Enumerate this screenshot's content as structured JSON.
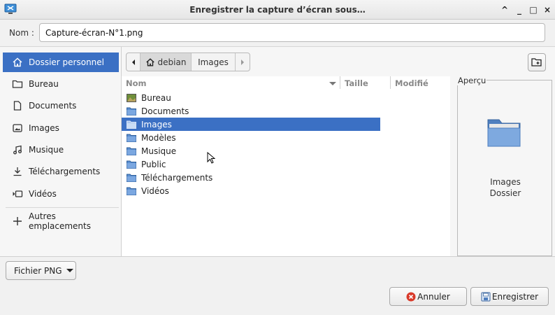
{
  "window": {
    "title": "Enregistrer la capture d’écran sous…",
    "controls": [
      "^",
      "_",
      "□",
      "×"
    ]
  },
  "name_field": {
    "label": "Nom :",
    "value": "Capture-écran-N°1.png"
  },
  "sidebar": {
    "items": [
      {
        "label": "Dossier personnel",
        "icon": "home-icon",
        "active": true
      },
      {
        "label": "Bureau",
        "icon": "folder-icon"
      },
      {
        "label": "Documents",
        "icon": "document-icon"
      },
      {
        "label": "Images",
        "icon": "image-icon"
      },
      {
        "label": "Musique",
        "icon": "music-icon"
      },
      {
        "label": "Téléchargements",
        "icon": "download-icon"
      },
      {
        "label": "Vidéos",
        "icon": "video-icon"
      },
      {
        "label": "Autres emplacements",
        "icon": "plus-icon"
      }
    ]
  },
  "pathbar": {
    "segments": [
      "debian",
      "Images"
    ],
    "current": "debian"
  },
  "file_list": {
    "columns": [
      "Nom",
      "Taille",
      "Modifié"
    ],
    "rows": [
      {
        "name": "Bureau",
        "icon": "desktop-folder-icon"
      },
      {
        "name": "Documents",
        "icon": "folder-icon"
      },
      {
        "name": "Images",
        "icon": "folder-icon",
        "selected": true
      },
      {
        "name": "Modèles",
        "icon": "folder-icon"
      },
      {
        "name": "Musique",
        "icon": "folder-icon"
      },
      {
        "name": "Public",
        "icon": "folder-icon"
      },
      {
        "name": "Téléchargements",
        "icon": "folder-icon"
      },
      {
        "name": "Vidéos",
        "icon": "folder-icon"
      }
    ]
  },
  "preview": {
    "legend": "Aperçu",
    "name": "Images",
    "kind": "Dossier"
  },
  "filter": {
    "label": "Fichier PNG"
  },
  "buttons": {
    "cancel": "Annuler",
    "save": "Enregistrer"
  },
  "colors": {
    "selection": "#3b70c4",
    "folder": "#5b8fd1"
  }
}
